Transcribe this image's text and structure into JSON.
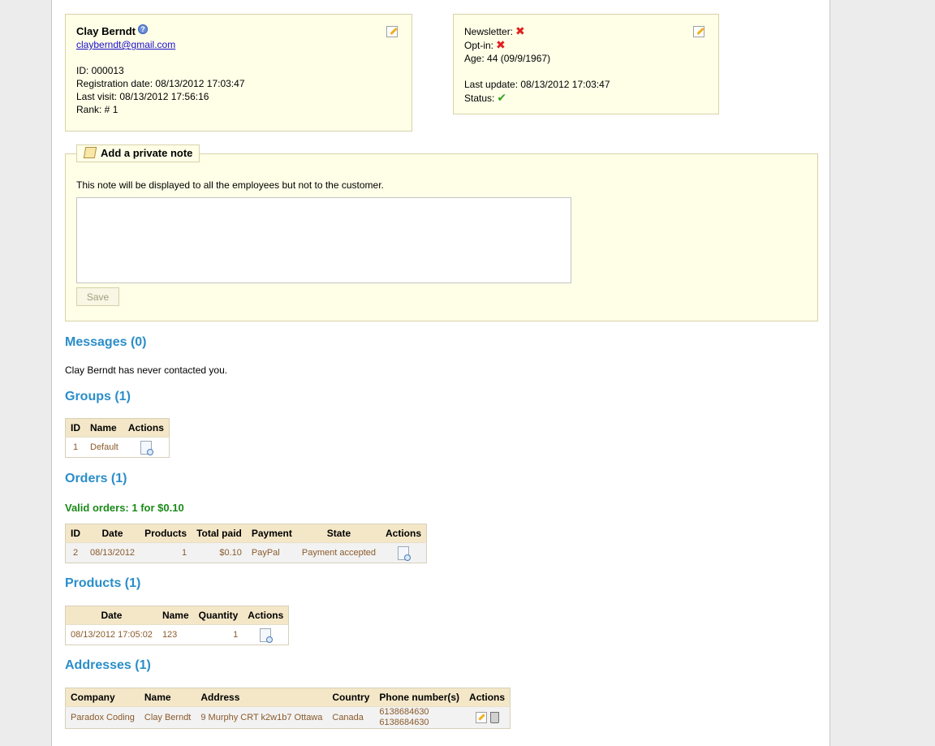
{
  "customer": {
    "name": "Clay Berndt",
    "email": "clayberndt@gmail.com",
    "id_label": "ID: 000013",
    "registration": "Registration date: 08/13/2012 17:03:47",
    "last_visit": "Last visit: 08/13/2012 17:56:16",
    "rank": "Rank: # 1"
  },
  "status_box": {
    "newsletter_label": "Newsletter:",
    "optin_label": "Opt-in:",
    "age": "Age: 44 (09/9/1967)",
    "last_update": "Last update: 08/13/2012 17:03:47",
    "status_label": "Status:"
  },
  "icons": {
    "help": "?",
    "cross": "✖",
    "check": "✔"
  },
  "private_note": {
    "legend": "Add a private note",
    "description": "This note will be displayed to all the employees but not to the customer.",
    "value": "",
    "save_label": "Save"
  },
  "messages": {
    "title": "Messages (0)",
    "text": "Clay Berndt has never contacted you."
  },
  "groups": {
    "title": "Groups (1)",
    "headers": [
      "ID",
      "Name",
      "Actions"
    ],
    "rows": [
      [
        "1",
        "Default"
      ]
    ]
  },
  "orders": {
    "title": "Orders (1)",
    "valid_label": "Valid orders: 1 for $0.10",
    "headers": [
      "ID",
      "Date",
      "Products",
      "Total paid",
      "Payment",
      "State",
      "Actions"
    ],
    "rows": [
      [
        "2",
        "08/13/2012",
        "1",
        "$0.10",
        "PayPal",
        "Payment accepted"
      ]
    ]
  },
  "products": {
    "title": "Products (1)",
    "headers": [
      "Date",
      "Name",
      "Quantity",
      "Actions"
    ],
    "rows": [
      [
        "08/13/2012 17:05:02",
        "123",
        "1"
      ]
    ]
  },
  "addresses": {
    "title": "Addresses (1)",
    "headers": [
      "Company",
      "Name",
      "Address",
      "Country",
      "Phone number(s)",
      "Actions"
    ],
    "rows": [
      [
        "Paradox Coding",
        "Clay Berndt",
        "9 Murphy CRT k2w1b7 Ottawa",
        "Canada",
        "6138684630",
        "6138684630"
      ]
    ]
  }
}
